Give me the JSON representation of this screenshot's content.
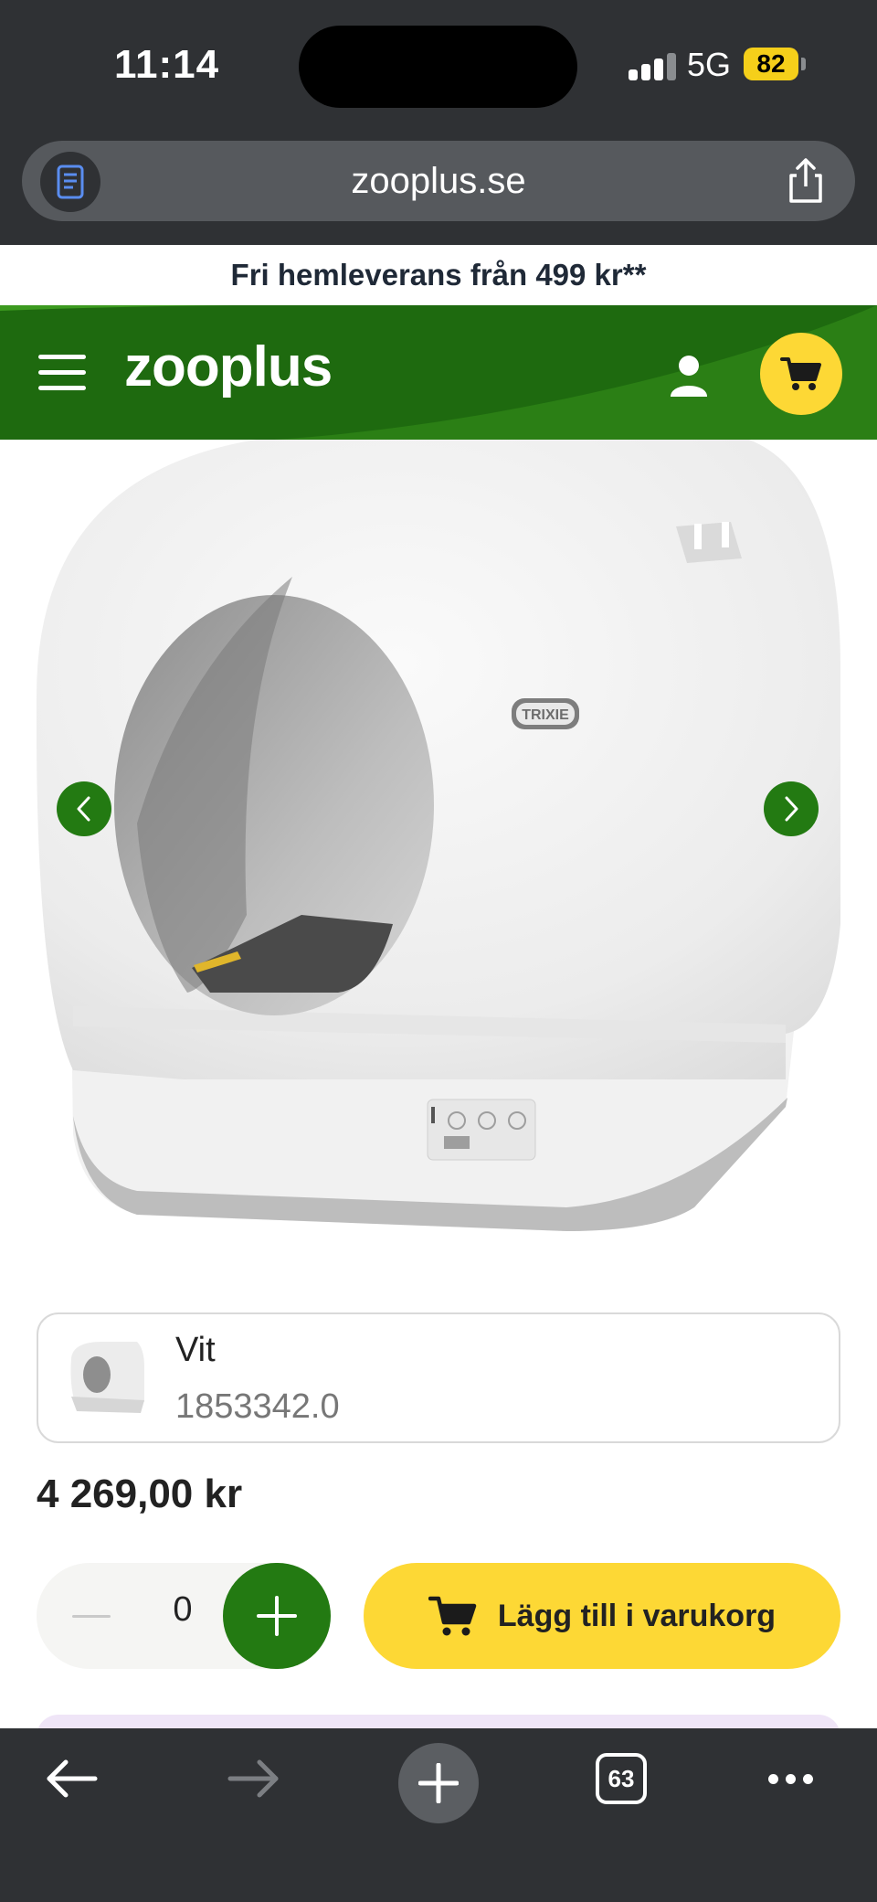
{
  "status_bar": {
    "time": "11:14",
    "network": "5G",
    "battery": "82"
  },
  "browser": {
    "url": "zooplus.se",
    "tab_count": "63"
  },
  "promo": {
    "text": "Fri hemleverans från 499 kr**"
  },
  "header": {
    "logo": "zooplus"
  },
  "product": {
    "brand_on_image": "TRIXIE",
    "variant": {
      "name": "Vit",
      "sku": "1853342.0"
    },
    "price": "4 269,00 kr",
    "quantity": "0",
    "add_to_cart_label": "Lägg till i varukorg"
  },
  "colors": {
    "brand_green": "#1e6a0f",
    "accent_yellow": "#fdd835",
    "browser_chrome": "#2f3134"
  }
}
